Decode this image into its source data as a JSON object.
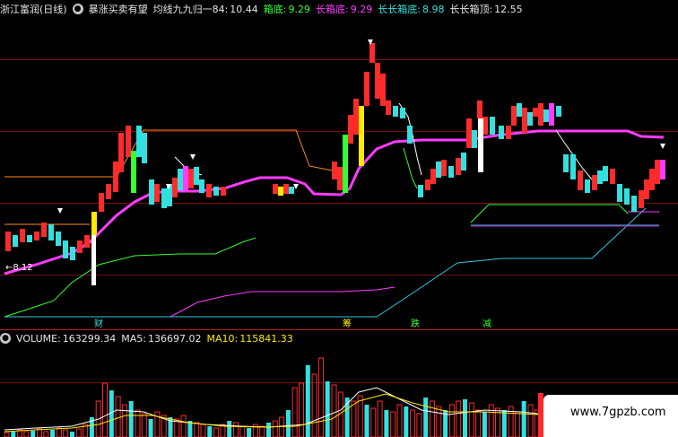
{
  "header": {
    "title": "浙江富润(日线)",
    "indicator": "暴涨买卖有望",
    "ma_label": "均线九九归一84:",
    "ma_value": "10.44",
    "box_label": "箱底:",
    "box_value": "9.29",
    "long_box_label": "长箱底:",
    "long_box_value": "9.29",
    "longlong_box_label": "长长箱底:",
    "longlong_box_value": "8.98",
    "longlong_top_label": "长长箱顶:",
    "longlong_top_value": "12.55"
  },
  "annotations": {
    "left_price": "←8.12",
    "cai": "财",
    "chou": "筹",
    "die": "跌",
    "jian": "减"
  },
  "volume": {
    "label": "VOLUME:",
    "value": "163299.34",
    "ma5_label": "MA5:",
    "ma5_value": "136697.02",
    "ma10_label": "MA10:",
    "ma10_value": "115841.33"
  },
  "watermark": "www.7gpzb.com",
  "colors": {
    "up": "#ff2b2b",
    "down": "#33e0e0",
    "ma": "#ff3cff",
    "yellow": "#ffea00",
    "green": "#33ff33",
    "pink_line": "#c000c0"
  }
}
